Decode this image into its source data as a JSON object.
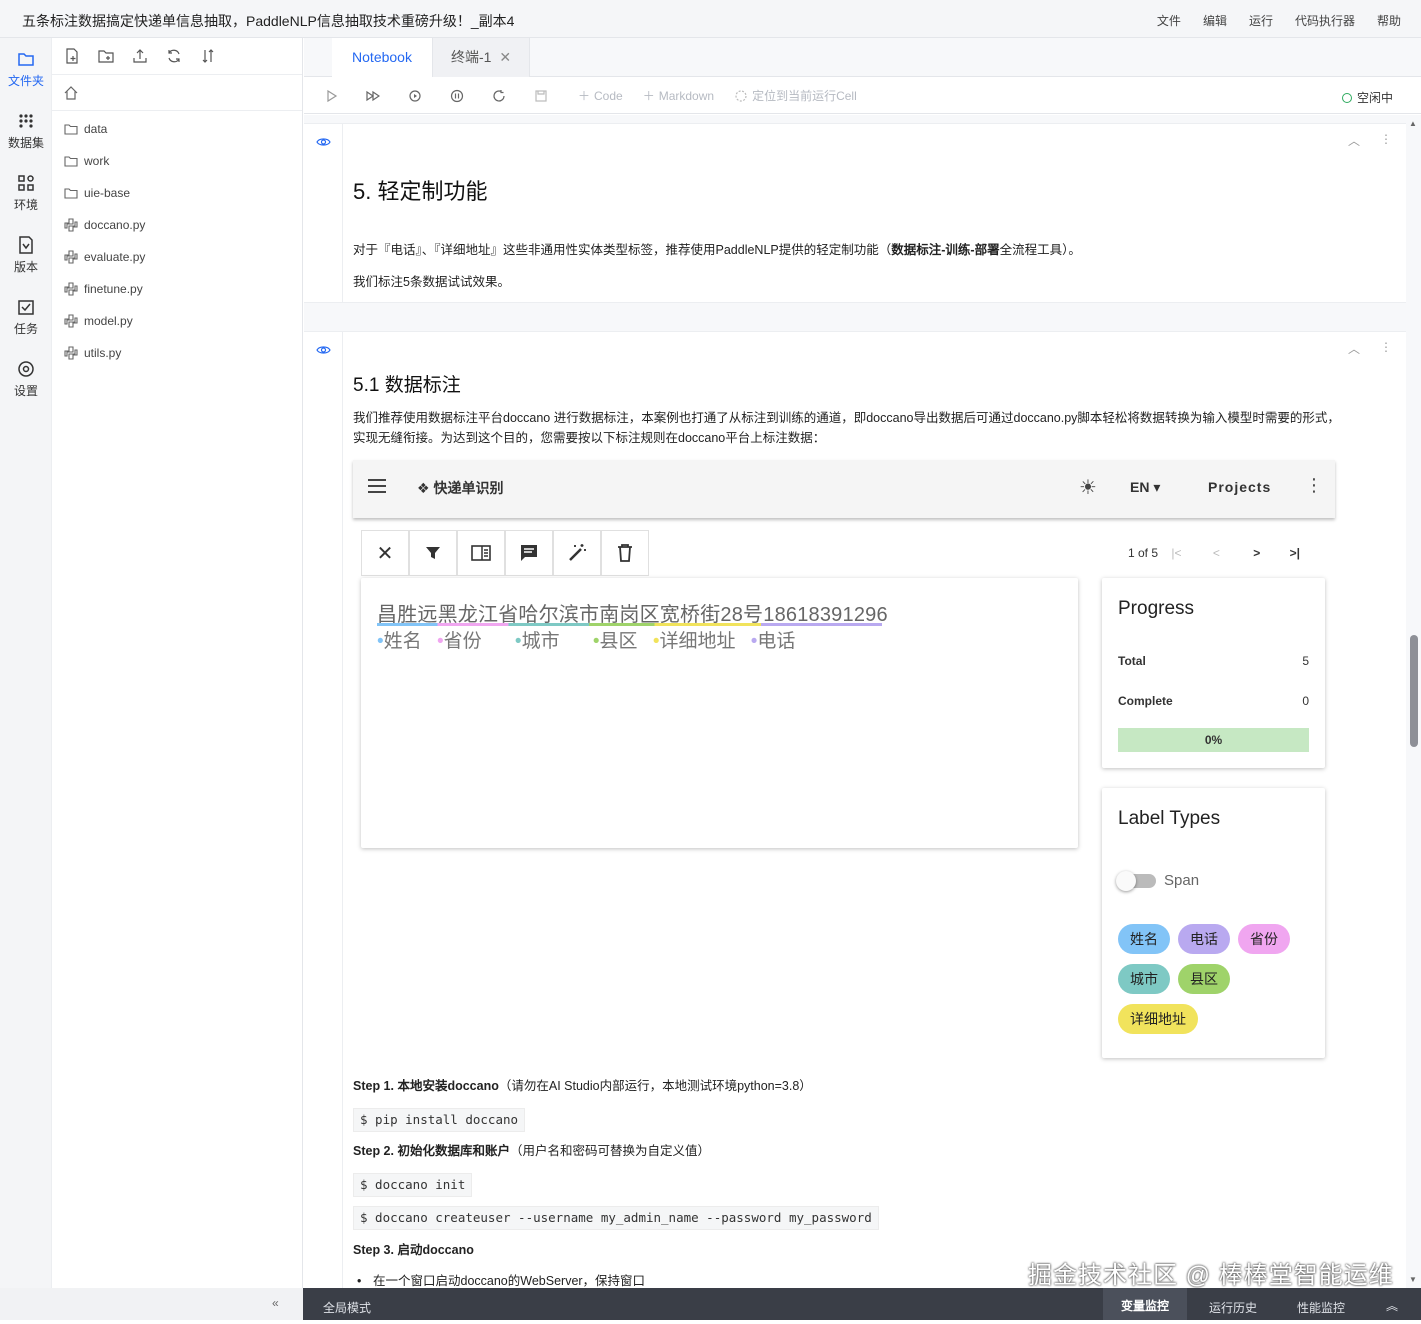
{
  "window": {
    "title": "五条标注数据搞定快递单信息抽取，PaddleNLP信息抽取技术重磅升级！_副本4"
  },
  "menu": [
    "文件",
    "编辑",
    "运行",
    "代码执行器",
    "帮助"
  ],
  "rail": [
    {
      "label": "文件夹",
      "icon": "folder-icon"
    },
    {
      "label": "数据集",
      "icon": "dataset-icon"
    },
    {
      "label": "环境",
      "icon": "grid-icon"
    },
    {
      "label": "版本",
      "icon": "version-icon"
    },
    {
      "label": "任务",
      "icon": "task-icon"
    },
    {
      "label": "设置",
      "icon": "gear-icon"
    }
  ],
  "files": [
    {
      "name": "data",
      "type": "folder"
    },
    {
      "name": "work",
      "type": "folder"
    },
    {
      "name": "uie-base",
      "type": "folder"
    },
    {
      "name": "doccano.py",
      "type": "python"
    },
    {
      "name": "evaluate.py",
      "type": "python"
    },
    {
      "name": "finetune.py",
      "type": "python"
    },
    {
      "name": "model.py",
      "type": "python"
    },
    {
      "name": "utils.py",
      "type": "python"
    }
  ],
  "tabs": [
    "Notebook",
    "终端-1"
  ],
  "toolbar": {
    "code": "Code",
    "markdown": "Markdown",
    "locate": "定位到当前运行Cell",
    "status": "空闲中"
  },
  "cell1": {
    "heading": "5. 轻定制功能",
    "p1_a": "对于『电话』、『详细地址』这些非通用性实体类型标签，推荐使用PaddleNLP提供的轻定制功能（",
    "p1_b": "数据标注-训练-部署",
    "p1_c": "全流程工具）。",
    "p2": "我们标注5条数据试试效果。"
  },
  "cell2": {
    "heading": "5.1 数据标注",
    "p1": "我们推荐使用数据标注平台doccano 进行数据标注，本案例也打通了从标注到训练的通道，即doccano导出数据后可通过doccano.py脚本轻松将数据转换为输入模型时需要的形式，实现无缝衔接。为达到这个目的，您需要按以下标注规则在doccano平台上标注数据：",
    "step1_b": "Step 1. 本地安装doccano",
    "step1": "（请勿在AI Studio内部运行，本地测试环境python=3.8）",
    "code1": "$ pip install doccano",
    "step2_b": "Step 2. 初始化数据库和账户",
    "step2": "（用户名和密码可替换为自定义值）",
    "code2": "$ doccano init",
    "code3": "$ doccano createuser --username my_admin_name --password my_password",
    "step3_b": "Step 3. 启动doccano",
    "bullet1": "在一个窗口启动doccano的WebServer，保持窗口"
  },
  "doccano": {
    "project": "快递单识别",
    "lang": "EN",
    "projects": "Projects",
    "pager": "1 of 5",
    "text": "昌胜远黑龙江省哈尔滨市南岗区宽桥街28号18618391296",
    "labels_inline": [
      "姓名",
      "省份",
      "城市",
      "县区",
      "详细地址",
      "电话"
    ],
    "progress": {
      "title": "Progress",
      "total_label": "Total",
      "total": "5",
      "complete_label": "Complete",
      "complete": "0",
      "percent": "0%"
    },
    "label_types": {
      "title": "Label Types",
      "span": "Span"
    },
    "chips": [
      {
        "name": "姓名",
        "color": "#82c4f7"
      },
      {
        "name": "电话",
        "color": "#b9a9f0"
      },
      {
        "name": "省份",
        "color": "#f0a6f0"
      },
      {
        "name": "城市",
        "color": "#7ec9c4"
      },
      {
        "name": "县区",
        "color": "#9fd36a"
      },
      {
        "name": "详细地址",
        "color": "#f1e35c"
      }
    ]
  },
  "bottom": {
    "mode": "全局模式",
    "var": "变量监控",
    "history": "运行历史",
    "perf": "性能监控"
  },
  "watermark": "掘金技术社区 @ 棒棒堂智能运维"
}
